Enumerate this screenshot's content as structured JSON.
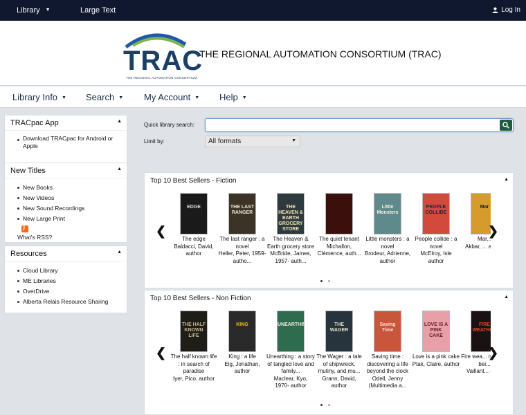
{
  "topbar": {
    "library_label": "Library",
    "large_text_label": "Large Text",
    "login_label": "Log In"
  },
  "header": {
    "logo_text": "TRAC",
    "logo_subtext": "THE REGIONAL AUTOMATION CONSORTIUM",
    "title": "THE REGIONAL AUTOMATION CONSORTIUM (TRAC)"
  },
  "nav": {
    "items": [
      {
        "label": "Library Info"
      },
      {
        "label": "Search"
      },
      {
        "label": "My Account"
      },
      {
        "label": "Help"
      }
    ]
  },
  "sidebar": {
    "app": {
      "title": "TRACpac App",
      "items": [
        "Download TRACpac for Android or Apple"
      ]
    },
    "new_titles": {
      "title": "New Titles",
      "items": [
        "New Books",
        "New Videos",
        "New Sound Recordings",
        "New Large Print"
      ],
      "rss_link": "What's RSS?"
    },
    "resources": {
      "title": "Resources",
      "items": [
        "Cloud Library",
        "ME Libraries",
        "OverDrive",
        "Alberta Relais Resource Sharing"
      ]
    }
  },
  "search": {
    "quick_label": "Quick library search:",
    "value": "",
    "limit_label": "Limit by:",
    "limit_value": "All formats"
  },
  "fiction": {
    "title": "Top 10 Best Sellers - Fiction",
    "books": [
      {
        "title": "The edge",
        "author": "Baldacci, David, author",
        "cover_text": "EDGE",
        "bg": "#1a1a1a",
        "fg": "#d9d9d9"
      },
      {
        "title": "The last ranger : a novel",
        "author": "Heller, Peter, 1959- autho...",
        "cover_text": "THE LAST RANGER",
        "bg": "#3a3326",
        "fg": "#f0e6d0"
      },
      {
        "title": "The Heaven & Earth grocery store",
        "author": "McBride, James, 1957- auth...",
        "cover_text": "THE HEAVEN & EARTH GROCERY STORE",
        "bg": "#2e3a3e",
        "fg": "#f2e3b5"
      },
      {
        "title": "The quiet tenant",
        "author": "Michallon, Clémence, auth...",
        "cover_text": "",
        "bg": "#3a0f0c",
        "fg": "#e8c0a0"
      },
      {
        "title": "Little monsters : a novel",
        "author": "Brodeur, Adrienne, author",
        "cover_text": "Little Monsters",
        "bg": "#5f8a8c",
        "fg": "#f4f0e0"
      },
      {
        "title": "People collide : a novel",
        "author": "McElroy, Isle author",
        "cover_text": "PEOPLE COLLIDE",
        "bg": "#d24a3c",
        "fg": "#1a2540"
      },
      {
        "title": "Mar...",
        "author": "Akbar, ... auth...",
        "cover_text": "Mar",
        "bg": "#d59b2b",
        "fg": "#1a1a1a"
      }
    ]
  },
  "nonfiction": {
    "title": "Top 10 Best Sellers - Non Fiction",
    "books": [
      {
        "title": "The half known life : in search of paradise",
        "author": "Iyer, Pico, author",
        "cover_text": "THE HALF KNOWN LIFE",
        "bg": "#1f1d18",
        "fg": "#c9b98a"
      },
      {
        "title": "King : a life",
        "author": "Eig, Jonathan, author",
        "cover_text": "KING",
        "bg": "#2a2a2a",
        "fg": "#f2c200"
      },
      {
        "title": "Unearthing : a story of tangled love and family...",
        "author": "Maclear, Kyo, 1970- author",
        "cover_text": "UNEARTHING",
        "bg": "#2e6b4f",
        "fg": "#f4efe0"
      },
      {
        "title": "The Wager : a tale of shipwreck, mutiny, and mu...",
        "author": "Grann, David, author",
        "cover_text": "THE WAGER",
        "bg": "#27333d",
        "fg": "#e8e0c8"
      },
      {
        "title": "Saving time : discovering a life beyond the clock",
        "author": "Odell, Jenny (Multimedia a...",
        "cover_text": "Saving Time",
        "bg": "#c8563a",
        "fg": "#f6e8d8"
      },
      {
        "title": "Love is a pink cake",
        "author": "Ptak, Claire, author",
        "cover_text": "LOVE IS A PINK CAKE",
        "bg": "#e8a0a8",
        "fg": "#6a1a2a"
      },
      {
        "title": "Fire wea... makin... bei...",
        "author": "Vaillant... aut...",
        "cover_text": "FIRE WEATHER",
        "bg": "#1a1212",
        "fg": "#e24a2a"
      }
    ]
  },
  "colors": {
    "topbar": "#101830",
    "brand": "#1c3f66",
    "search_button": "#1e5c3c"
  }
}
